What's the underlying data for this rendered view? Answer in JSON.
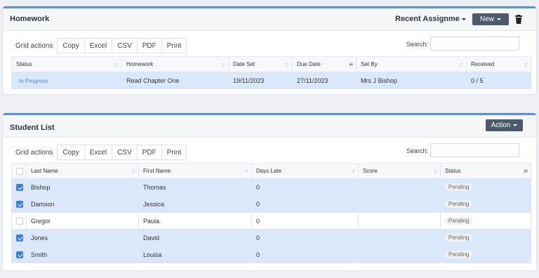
{
  "homework": {
    "title": "Homework",
    "recent_label": "Recent Assignments",
    "new_label": "New",
    "toolbar": {
      "label": "Grid actions",
      "copy": "Copy",
      "excel": "Excel",
      "csv": "CSV",
      "pdf": "PDF",
      "print": "Print"
    },
    "search_label": "Search:",
    "search_value": "",
    "columns": [
      "Status",
      "Homework",
      "Date Set",
      "Due Date",
      "Set By",
      "Received"
    ],
    "rows": [
      {
        "status": "In Progress",
        "homework": "Read Chapter One",
        "date_set": "19/11/2023",
        "due_date": "27/11/2023",
        "set_by": "Mrs J Bishop",
        "received": "0 / 5"
      }
    ]
  },
  "students": {
    "title": "Student List",
    "action_label": "Action",
    "toolbar": {
      "label": "Grid actions",
      "copy": "Copy",
      "excel": "Excel",
      "csv": "CSV",
      "pdf": "PDF",
      "print": "Print"
    },
    "search_label": "Search:",
    "search_value": "",
    "columns": [
      "Last Name",
      "First Name",
      "Days Late",
      "Score",
      "Status"
    ],
    "rows": [
      {
        "checked": true,
        "last": "Bishop",
        "first": "Thomas",
        "days_late": "0",
        "score": "",
        "status": "Pending"
      },
      {
        "checked": true,
        "last": "Damson",
        "first": "Jessica",
        "days_late": "0",
        "score": "",
        "status": "Pending"
      },
      {
        "checked": false,
        "last": "Gregor",
        "first": "Paula",
        "days_late": "0",
        "score": "",
        "status": "Pending"
      },
      {
        "checked": true,
        "last": "Jones",
        "first": "David",
        "days_late": "0",
        "score": "",
        "status": "Pending"
      },
      {
        "checked": true,
        "last": "Smith",
        "first": "Louisa",
        "days_late": "0",
        "score": "",
        "status": "Pending"
      }
    ]
  },
  "colors": {
    "accent": "#5b8fd6",
    "selected_row": "#dbe7fa",
    "dark_button": "#4d5a6b",
    "checkbox": "#3b7fd9"
  }
}
